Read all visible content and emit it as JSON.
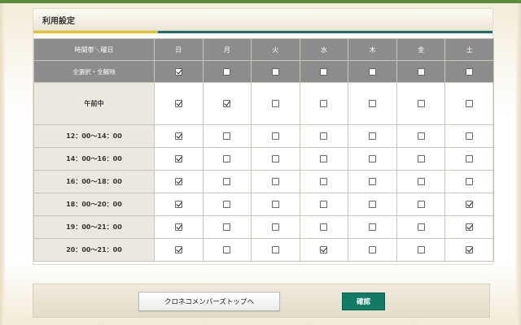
{
  "panel": {
    "title": "利用設定"
  },
  "table": {
    "corner_label": "時間帯＼曜日",
    "days": [
      "日",
      "月",
      "火",
      "水",
      "木",
      "金",
      "土"
    ],
    "select_all_label": "全選択・全解除",
    "select_all_checks": [
      true,
      false,
      false,
      false,
      false,
      false,
      false
    ],
    "rows": [
      {
        "label": "午前中",
        "checks": [
          true,
          true,
          false,
          false,
          false,
          false,
          false
        ]
      },
      {
        "label": "12：00〜14：00",
        "checks": [
          true,
          false,
          false,
          false,
          false,
          false,
          false
        ]
      },
      {
        "label": "14：00〜16：00",
        "checks": [
          true,
          false,
          false,
          false,
          false,
          false,
          false
        ]
      },
      {
        "label": "16：00〜18：00",
        "checks": [
          true,
          false,
          false,
          false,
          false,
          false,
          false
        ]
      },
      {
        "label": "18：00〜20：00",
        "checks": [
          true,
          false,
          false,
          false,
          false,
          false,
          true
        ]
      },
      {
        "label": "19：00〜21：00",
        "checks": [
          true,
          false,
          false,
          false,
          false,
          false,
          true
        ]
      },
      {
        "label": "20：00〜21：00",
        "checks": [
          true,
          false,
          false,
          true,
          false,
          false,
          true
        ]
      }
    ]
  },
  "footer": {
    "top_button_label": "クロネコメンバーズトップへ",
    "confirm_button_label": "確認"
  },
  "colors": {
    "header_gray": "#8c8c8c",
    "label_bg": "#ebe8df",
    "confirm_green": "#117b66",
    "rule_yellow": "#e9c12b",
    "rule_teal": "#1f6e6e"
  }
}
